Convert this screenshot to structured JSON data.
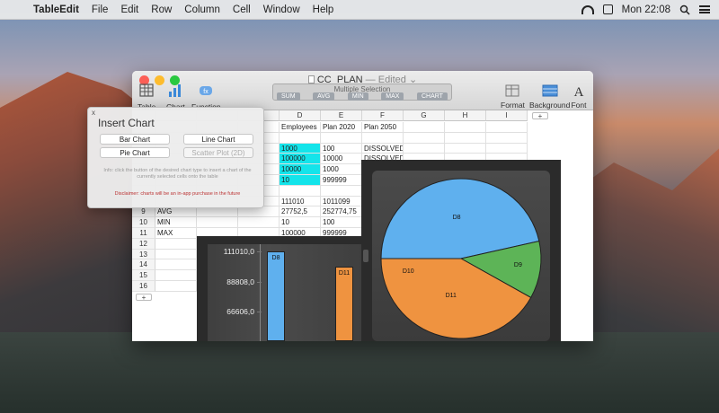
{
  "menubar": {
    "app": "TableEdit",
    "items": [
      "File",
      "Edit",
      "Row",
      "Column",
      "Cell",
      "Window",
      "Help"
    ],
    "clock": "Mon 22:08"
  },
  "window": {
    "title": "CC_PLAN",
    "status": "— Edited ⌄",
    "toolbar": {
      "table": "Table",
      "chart": "Chart",
      "function": "Function",
      "multi_selection": "Multiple Selection",
      "ms_buttons": [
        "SUM",
        "AVG",
        "MIN",
        "MAX",
        "CHART"
      ],
      "format": "Format",
      "background": "Background",
      "font": "Font"
    },
    "columns": [
      "D",
      "E",
      "F",
      "G",
      "H",
      "I"
    ],
    "add_column": "+",
    "add_row": "+",
    "row_numbers": [
      "9",
      "10",
      "11",
      "12",
      "13",
      "14",
      "15",
      "16"
    ],
    "rows": [
      [
        "Employees",
        "Plan 2020",
        "Plan 2050"
      ],
      [
        "",
        "",
        ""
      ],
      [
        "1000",
        "100",
        "DISSOLVED"
      ],
      [
        "100000",
        "10000",
        "DISSOLVED"
      ],
      [
        "10000",
        "1000",
        ""
      ],
      [
        "10",
        "999999",
        ""
      ],
      [
        "",
        "",
        ""
      ],
      [
        "111010",
        "1011099",
        ""
      ],
      [
        "27752,5",
        "252774,75",
        ""
      ],
      [
        "10",
        "100",
        ""
      ],
      [
        "100000",
        "999999",
        ""
      ]
    ],
    "row_labels": {
      "9": "AVG",
      "10": "MIN",
      "11": "MAX"
    },
    "partial_left_cell": "w"
  },
  "insert_chart": {
    "close": "x",
    "title": "Insert Chart",
    "bar": "Bar Chart",
    "line": "Line Chart",
    "pie": "Pie Chart",
    "scatter": "Scatter Plot (2D)",
    "info": "Info: click the button of the desired chart type to insert a chart of the currently selected cells onto the table",
    "disclaimer": "Disclaimer: charts will be an in-app purchase in the future"
  },
  "chart_data": [
    {
      "type": "bar",
      "categories": [
        "D8",
        "D11"
      ],
      "values": [
        111010,
        100000
      ],
      "yticks": [
        "111010,0",
        "88808,0",
        "66606,0"
      ],
      "ytick_values": [
        111010,
        88808,
        66606
      ],
      "ylim": [
        60000,
        111010
      ],
      "colors": [
        "#5fb0ee",
        "#ef9340"
      ]
    },
    {
      "type": "pie",
      "labels": [
        "D8",
        "D9",
        "D10",
        "D11"
      ],
      "values": [
        111010,
        27752.5,
        10,
        100000
      ],
      "colors": [
        "#5fb0ee",
        "#5db457",
        "#ef9340",
        "#ef9340"
      ]
    }
  ]
}
